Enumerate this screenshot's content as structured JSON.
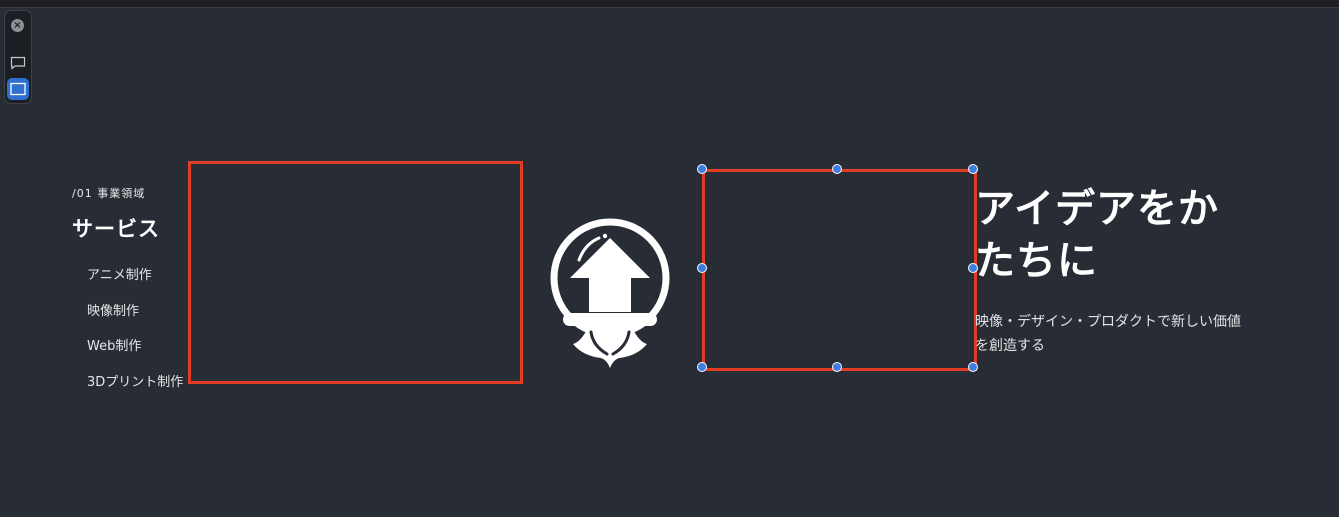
{
  "toolbar": {
    "close_glyph": "×",
    "items": [
      {
        "name": "comment-tool",
        "icon": "comment-icon"
      },
      {
        "name": "frame-tool",
        "icon": "frame-icon",
        "active": true
      }
    ]
  },
  "services": {
    "eyebrow": "/01 事業領域",
    "title": "サービス",
    "items": [
      "アニメ制作",
      "映像制作",
      "Web制作",
      "3Dプリント制作"
    ]
  },
  "hero": {
    "headline_line1": "アイデアをか",
    "headline_line2": "たちに",
    "tagline": "映像・デザイン・プロダクトで新しい価値を創造する"
  },
  "colors": {
    "background": "#282d35",
    "selection_border": "#e23d22",
    "handle": "#3d7ee0",
    "accent_active": "#2e6fd1"
  }
}
